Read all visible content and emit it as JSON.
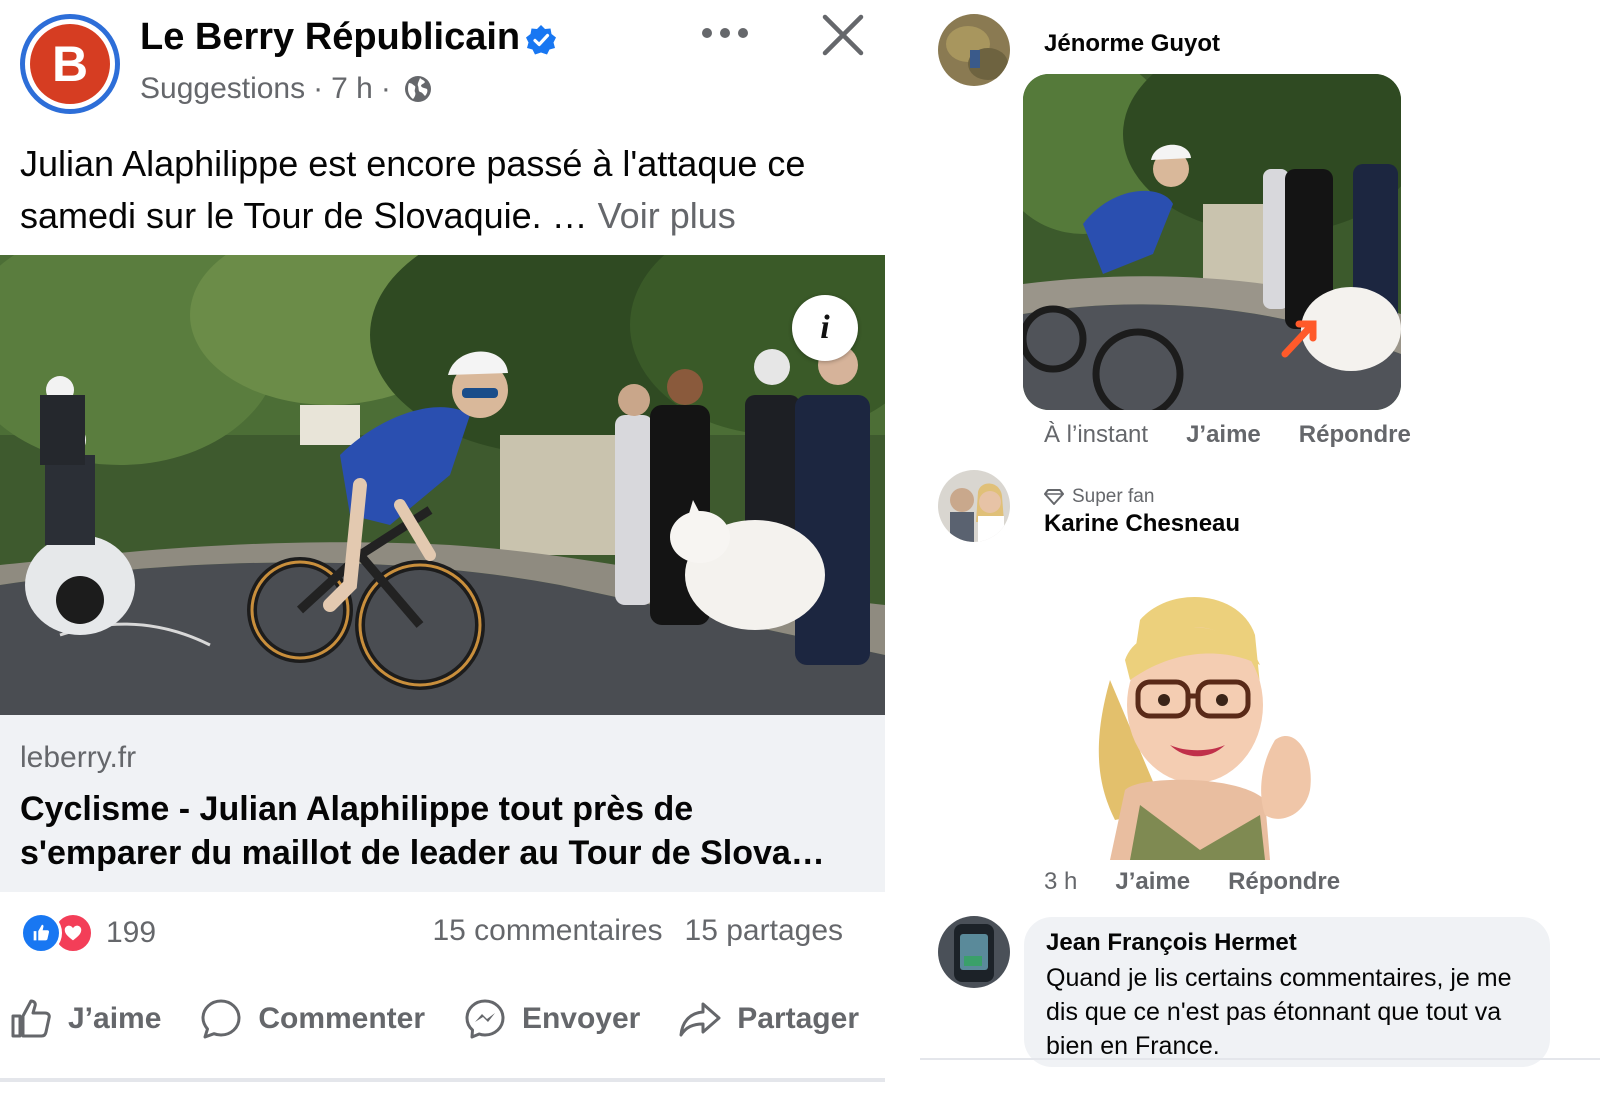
{
  "post": {
    "page_name": "Le Berry Républicain",
    "avatar_letter": "B",
    "meta_suggestions": "Suggestions",
    "meta_sep1": "·",
    "meta_time": "7 h",
    "meta_sep2": "·",
    "caption_text": "Julian Alaphilippe est encore passé à l'attaque ce samedi sur le Tour de Slovaquie. …",
    "caption_more": "Voir plus",
    "info_label": "i",
    "link_domain": "leberry.fr",
    "link_title": "Cyclisme - Julian Alaphilippe tout près de s'emparer du maillot de leader au Tour de Slova…",
    "reaction_count": "199",
    "comments_count": "15 commentaires",
    "shares_count": "15 partages",
    "actions": {
      "like": "J’aime",
      "comment": "Commenter",
      "send": "Envoyer",
      "share": "Partager"
    }
  },
  "comments": [
    {
      "author": "Jénorme Guyot",
      "time": "À l’instant",
      "like": "J’aime",
      "reply": "Répondre"
    },
    {
      "badge": "Super fan",
      "author": "Karine Chesneau",
      "time": "3 h",
      "like": "J’aime",
      "reply": "Répondre"
    },
    {
      "author": "Jean François Hermet",
      "text": "Quand je lis certains commentaires, je me dis que ce n'est pas étonnant que tout va bien en France."
    }
  ],
  "colors": {
    "accent": "#1877f2",
    "love": "#f33e58",
    "muted_text": "#65676b",
    "bubble_bg": "#f0f2f5",
    "brand_red": "#d63d22"
  }
}
